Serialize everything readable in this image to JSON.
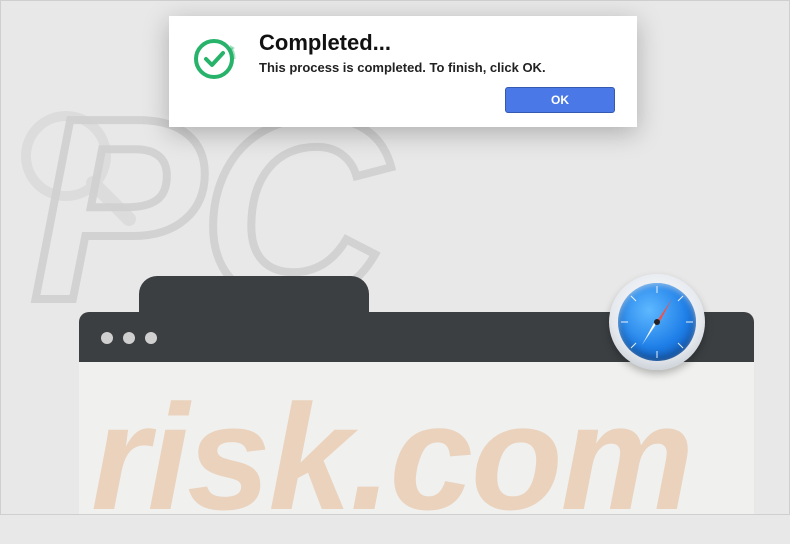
{
  "dialog": {
    "title": "Completed...",
    "message": "This process is completed. To finish, click OK.",
    "ok_label": "OK"
  },
  "watermark": {
    "main": "PC",
    "sub": "risk.com"
  },
  "icons": {
    "check": "check-circle-icon",
    "safari": "safari-icon"
  },
  "colors": {
    "accent": "#4a78e6",
    "check": "#27b36a"
  }
}
